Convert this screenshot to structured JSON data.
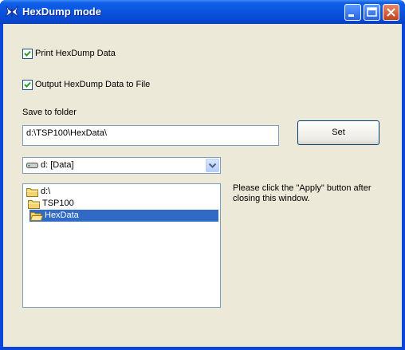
{
  "window": {
    "title": "HexDump mode"
  },
  "options": {
    "print_label": "Print HexDump Data",
    "print_checked": true,
    "output_label": "Output HexDump Data to File",
    "output_checked": true
  },
  "folder": {
    "label": "Save to folder",
    "path": "d:\\TSP100\\HexData\\",
    "set_label": "Set"
  },
  "drive": {
    "selected": "d: [Data]"
  },
  "tree": {
    "items": [
      {
        "label": "d:\\",
        "selected": false
      },
      {
        "label": "TSP100",
        "selected": false
      },
      {
        "label": "HexData",
        "selected": true
      }
    ]
  },
  "note": {
    "line1": "Please click the \"Apply\" button after",
    "line2": "closing this window."
  },
  "icons": {
    "app": "butterfly-icon",
    "minimize": "minimize-icon",
    "maximize": "maximize-icon",
    "close": "close-icon",
    "drive": "drive-icon",
    "folder": "folder-icon"
  }
}
